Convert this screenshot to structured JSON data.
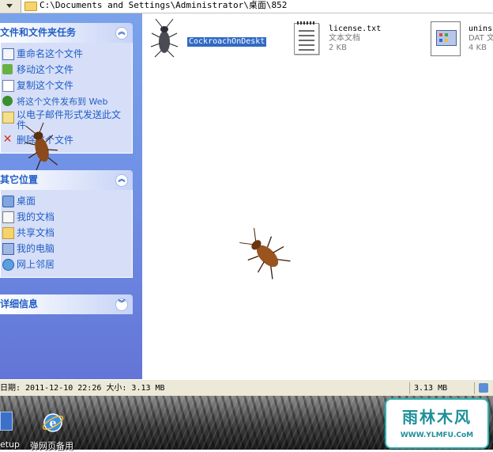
{
  "address": {
    "path": "C:\\Documents and Settings\\Administrator\\桌面\\852"
  },
  "taskpane": {
    "file_tasks": {
      "title": "文件和文件夹任务",
      "items": [
        {
          "label": "重命名这个文件",
          "icon": "rename-icon"
        },
        {
          "label": "移动这个文件",
          "icon": "move-icon"
        },
        {
          "label": "复制这个文件",
          "icon": "copy-icon"
        },
        {
          "label": "将这个文件发布到 Web",
          "icon": "web-publish-icon"
        },
        {
          "label": "以电子邮件形式发送此文件",
          "icon": "email-icon"
        },
        {
          "label": "删除这个文件",
          "icon": "delete-icon"
        }
      ]
    },
    "other_places": {
      "title": "其它位置",
      "items": [
        {
          "label": "桌面",
          "icon": "desktop-icon"
        },
        {
          "label": "我的文档",
          "icon": "my-documents-icon"
        },
        {
          "label": "共享文档",
          "icon": "shared-documents-icon"
        },
        {
          "label": "我的电脑",
          "icon": "my-computer-icon"
        },
        {
          "label": "网上邻居",
          "icon": "network-places-icon"
        }
      ]
    },
    "details": {
      "title": "详细信息"
    }
  },
  "files": [
    {
      "name": "CockroachOnDeskt",
      "selected": true,
      "icon": "cockroach-app-icon"
    },
    {
      "name": "license.txt",
      "type": "文本文档",
      "size": "2 KB",
      "icon": "text-file-icon"
    },
    {
      "name": "unins",
      "type": "DAT 文",
      "size": "4 KB",
      "icon": "dat-file-icon"
    }
  ],
  "statusbar": {
    "info": "日期: 2011-12-10 22:26 大小: 3.13 MB",
    "size": "3.13 MB"
  },
  "desktop": {
    "icons": [
      {
        "label": "etup",
        "icon": "setup-icon"
      },
      {
        "label": "弹网页备用",
        "icon": "ie-icon"
      }
    ],
    "logo": {
      "main": "雨林木风",
      "url": "WWW.YLMFU.CoM"
    }
  },
  "colors": {
    "taskpane_bg": "#7090e0",
    "panel_body": "#d6dff7",
    "link": "#215dc6",
    "selection": "#316ac5"
  }
}
